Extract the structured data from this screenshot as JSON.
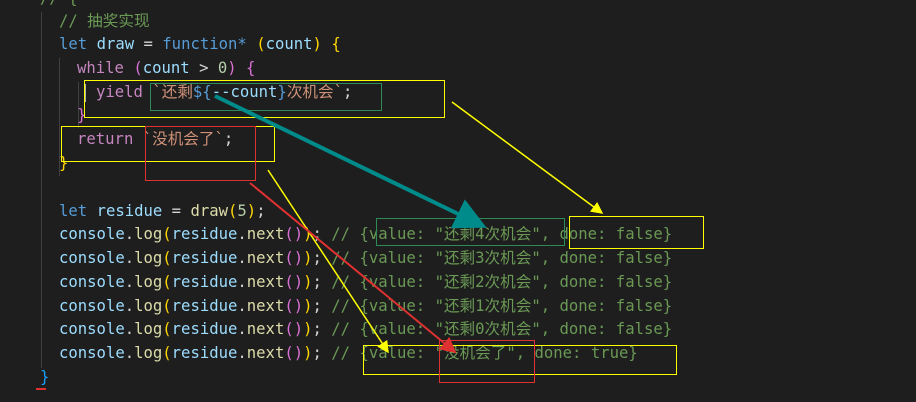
{
  "code": {
    "top_fragment": "// {",
    "comment_title": "// 抽奖实现",
    "decl": {
      "let": "let",
      "name": "draw",
      "eq": " = ",
      "function": "function",
      "star": "*",
      "param": "count",
      "open": " {"
    },
    "while_line": {
      "kw": "while",
      "cond_var": "count",
      "op": " > ",
      "num": "0",
      "open": " {"
    },
    "yield_line": {
      "kw": "yield",
      "tpl_open": "`还剩",
      "interp_open": "${",
      "expr": "--count",
      "interp_close": "}",
      "tpl_close": "次机会`",
      "semi": ";"
    },
    "close_while": "}",
    "return_line": {
      "kw": "return",
      "str": "`没机会了`",
      "semi": ";"
    },
    "close_fn": "}",
    "residue_line": {
      "let": "let",
      "name": "residue",
      "eq": " = ",
      "fn": "draw",
      "arg": "5",
      "end": ");"
    },
    "console_prefix": {
      "obj": "console",
      "method": "log",
      "arg": "residue",
      "next": "next"
    },
    "results": [
      "// {value: \"还剩4次机会\", done: false}",
      "// {value: \"还剩3次机会\", done: false}",
      "// {value: \"还剩2次机会\", done: false}",
      "// {value: \"还剩1次机会\", done: false}",
      "// {value: \"还剩0次机会\", done: false}",
      "// {value: \"没机会了\", done: true}"
    ],
    "close_block": "}"
  },
  "colors": {
    "background": "#1e1e1e",
    "keyword": "#569cd6",
    "control": "#c586c0",
    "variable": "#9cdcfe",
    "function": "#dcdcaa",
    "string": "#ce9178",
    "comment": "#6a9955",
    "annotation_yellow": "#ffff00",
    "annotation_red": "#e03131",
    "annotation_teal": "#008b8b"
  }
}
